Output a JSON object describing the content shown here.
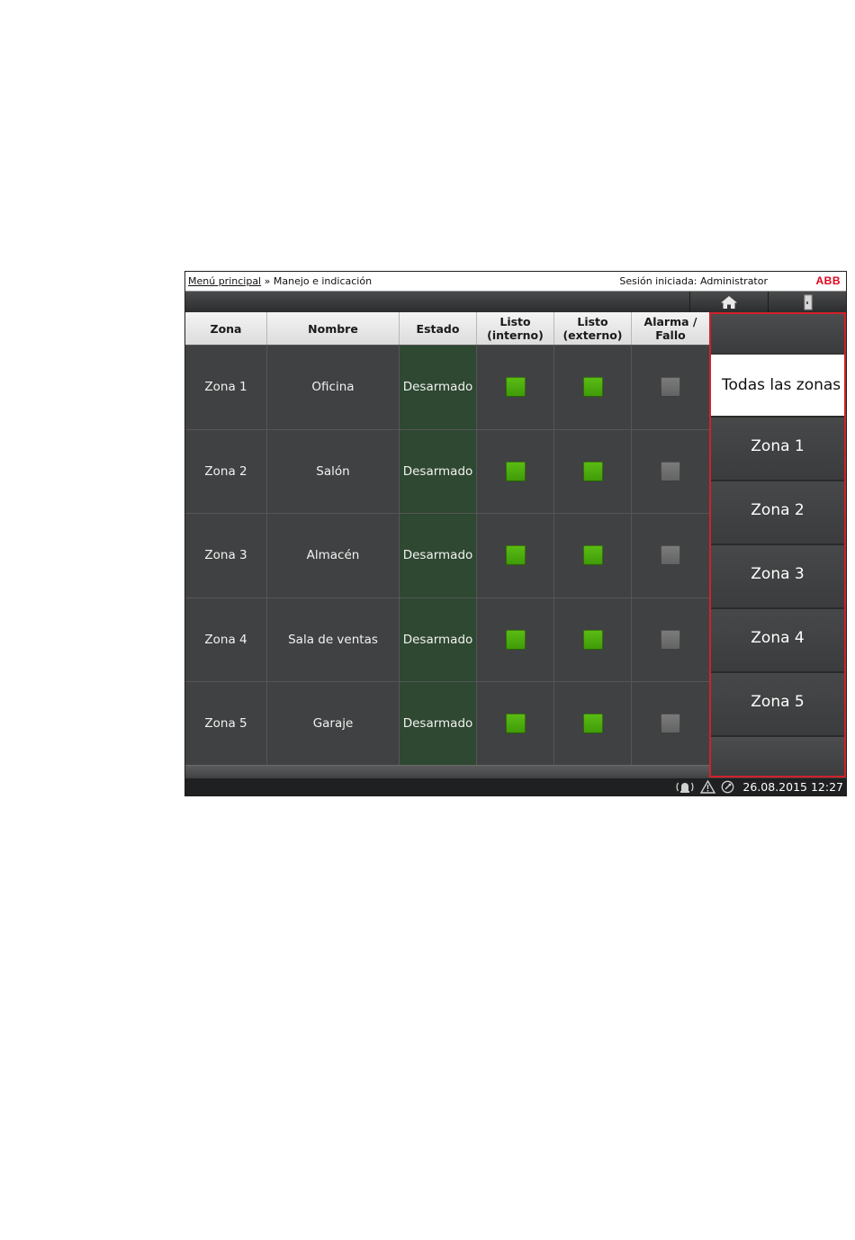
{
  "topbar": {
    "breadcrumb_link": "Menú principal",
    "breadcrumb_separator": " » ",
    "breadcrumb_current": "Manejo e indicación",
    "session_text": "Sesión iniciada: Administrator",
    "logo_text": "ABB"
  },
  "navbar": {
    "home_icon": "home-icon",
    "door_icon": "door-icon"
  },
  "table": {
    "headers": [
      "Zona",
      "Nombre",
      "Estado",
      "Listo\n(interno)",
      "Listo\n(externo)",
      "Alarma /\nFallo"
    ],
    "rows": [
      {
        "zona": "Zona 1",
        "nombre": "Oficina",
        "estado": "Desarmado",
        "listo_interno": "green",
        "listo_externo": "green",
        "alarma_fallo": "gray"
      },
      {
        "zona": "Zona 2",
        "nombre": "Salón",
        "estado": "Desarmado",
        "listo_interno": "green",
        "listo_externo": "green",
        "alarma_fallo": "gray"
      },
      {
        "zona": "Zona 3",
        "nombre": "Almacén",
        "estado": "Desarmado",
        "listo_interno": "green",
        "listo_externo": "green",
        "alarma_fallo": "gray"
      },
      {
        "zona": "Zona 4",
        "nombre": "Sala de ventas",
        "estado": "Desarmado",
        "listo_interno": "green",
        "listo_externo": "green",
        "alarma_fallo": "gray"
      },
      {
        "zona": "Zona 5",
        "nombre": "Garaje",
        "estado": "Desarmado",
        "listo_interno": "green",
        "listo_externo": "green",
        "alarma_fallo": "gray"
      }
    ]
  },
  "side_panel": {
    "all_label": "Todas las zonas",
    "items": [
      "Zona 1",
      "Zona 2",
      "Zona 3",
      "Zona 4",
      "Zona 5"
    ]
  },
  "statusbar": {
    "icons": [
      "alarm-broadcast-icon",
      "warning-icon",
      "power-icon"
    ],
    "datetime": "26.08.2015 12:27"
  },
  "colors": {
    "led_green": "#4caf0e",
    "led_gray": "#707070",
    "estado_bg": "#2e4831",
    "highlight_border": "#d4202a",
    "logo_red": "#e2001a"
  }
}
